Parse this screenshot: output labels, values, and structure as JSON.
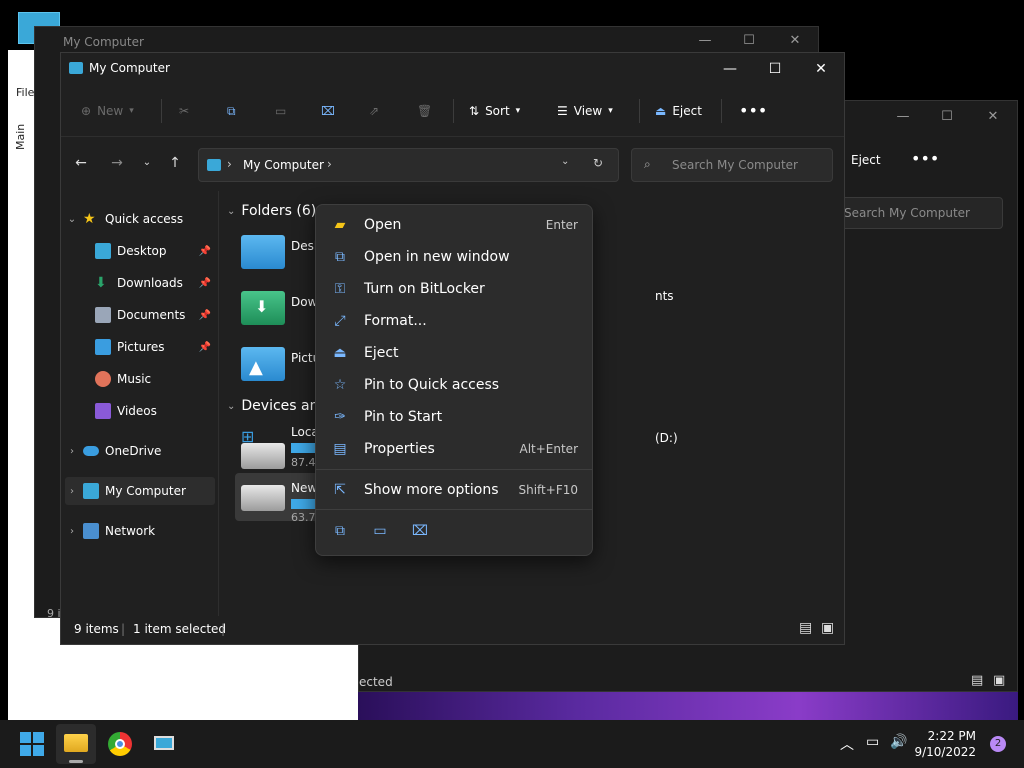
{
  "window_title": "My Computer",
  "bg_window_title": "My Computer",
  "bg_right": {
    "eject": "Eject",
    "search_placeholder": "Search My Computer",
    "status": "ected"
  },
  "bg_left": {
    "file": "File",
    "main": "Main",
    "items": "9 i"
  },
  "toolbar": {
    "new": "New",
    "sort": "Sort",
    "view": "View",
    "eject": "Eject"
  },
  "address": {
    "path": "My Computer",
    "search_placeholder": "Search My Computer"
  },
  "nav": {
    "quick_access": "Quick access",
    "items": [
      {
        "label": "Desktop",
        "pinned": true
      },
      {
        "label": "Downloads",
        "pinned": true
      },
      {
        "label": "Documents",
        "pinned": true
      },
      {
        "label": "Pictures",
        "pinned": true
      },
      {
        "label": "Music",
        "pinned": false
      },
      {
        "label": "Videos",
        "pinned": false
      }
    ],
    "onedrive": "OneDrive",
    "my_computer": "My Computer",
    "network": "Network"
  },
  "content": {
    "folders_header": "Folders (6)",
    "folders": [
      "Desk",
      "Dow",
      "Pictu"
    ],
    "folder_extra": "nts",
    "devices_header": "Devices and",
    "drives": [
      {
        "name": "Loca",
        "size": "87.4"
      },
      {
        "name": "New",
        "size": "63.7"
      }
    ],
    "drive_extra": "(D:)"
  },
  "status": {
    "items": "9 items",
    "selected": "1 item selected"
  },
  "context_menu": {
    "items": [
      {
        "label": "Open",
        "shortcut": "Enter"
      },
      {
        "label": "Open in new window",
        "shortcut": ""
      },
      {
        "label": "Turn on BitLocker",
        "shortcut": ""
      },
      {
        "label": "Format...",
        "shortcut": ""
      },
      {
        "label": "Eject",
        "shortcut": ""
      },
      {
        "label": "Pin to Quick access",
        "shortcut": ""
      },
      {
        "label": "Pin to Start",
        "shortcut": ""
      },
      {
        "label": "Properties",
        "shortcut": "Alt+Enter"
      }
    ],
    "more": {
      "label": "Show more options",
      "shortcut": "Shift+F10"
    }
  },
  "taskbar": {
    "time": "2:22 PM",
    "date": "9/10/2022",
    "notifications": "2"
  },
  "colors": {
    "accent": "#3fa9e8",
    "folder_blue": "#3a9de0",
    "folder_green": "#2aa36a",
    "window_bg": "#202020",
    "menu_bg": "#2c2c2c"
  }
}
